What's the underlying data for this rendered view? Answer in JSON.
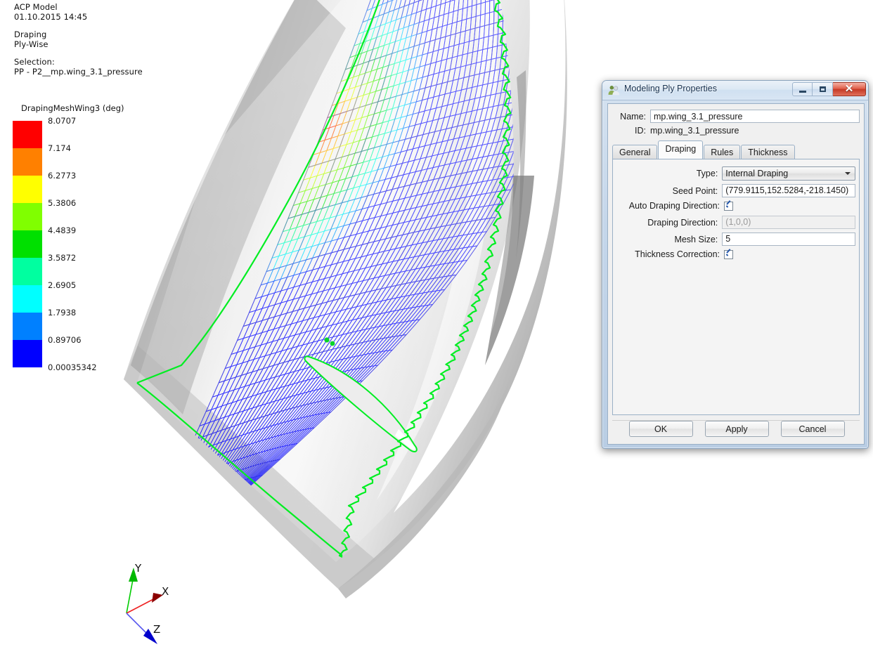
{
  "annotations": {
    "model_title": "ACP Model",
    "timestamp": "01.10.2015 14:45",
    "mode_title": "Draping",
    "mode_sub": "Ply-Wise",
    "selection_title": "Selection:",
    "selection_value": "PP - P2__mp.wing_3.1_pressure"
  },
  "legend": {
    "title": "DrapingMeshWing3 (deg)",
    "unit": "deg",
    "ticks": [
      "8.0707",
      "7.174",
      "6.2773",
      "5.3806",
      "4.4839",
      "3.5872",
      "2.6905",
      "1.7938",
      "0.89706",
      "0.00035342"
    ],
    "band_colors": [
      "#ff0000",
      "#ff8000",
      "#ffff00",
      "#80ff00",
      "#00e000",
      "#00ffa0",
      "#00ffff",
      "#0080ff",
      "#0000ff"
    ]
  },
  "triad": {
    "x_label": "X",
    "y_label": "Y",
    "z_label": "Z",
    "x_color": "#aa0000",
    "y_color": "#00aa00",
    "z_color": "#0000cc"
  },
  "viewport": {
    "background": "#ffffff",
    "surface_color": "#d8d8d8",
    "boundary_color": "#00ee22",
    "mesh_low_color": "#0000ff",
    "mesh_high_color": "#ff0000"
  },
  "dialog": {
    "title": "Modeling Ply Properties",
    "icon": "users-icon",
    "caption_buttons": {
      "minimize": "Minimize",
      "maximize": "Maximize",
      "close": "Close"
    },
    "name_label": "Name:",
    "name_value": "mp.wing_3.1_pressure",
    "id_label": "ID:",
    "id_value": "mp.wing_3.1_pressure",
    "tabs": [
      {
        "label": "General",
        "selected": false
      },
      {
        "label": "Draping",
        "selected": true
      },
      {
        "label": "Rules",
        "selected": false
      },
      {
        "label": "Thickness",
        "selected": false
      }
    ],
    "fields": {
      "type_label": "Type:",
      "type_value": "Internal Draping",
      "seed_point_label": "Seed Point:",
      "seed_point_value": "(779.9115,152.5284,-218.1450)",
      "auto_draping_label": "Auto Draping Direction:",
      "auto_draping_checked": true,
      "draping_direction_label": "Draping Direction:",
      "draping_direction_value": "(1,0,0)",
      "draping_direction_enabled": false,
      "mesh_size_label": "Mesh Size:",
      "mesh_size_value": "5",
      "thickness_correction_label": "Thickness Correction:",
      "thickness_correction_checked": true
    },
    "buttons": {
      "ok": "OK",
      "apply": "Apply",
      "cancel": "Cancel"
    }
  }
}
